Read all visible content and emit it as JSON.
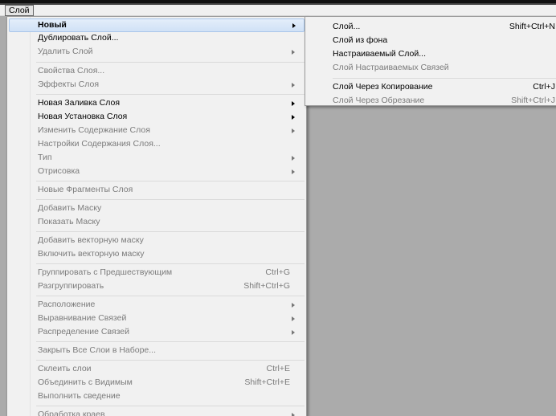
{
  "menubar": {
    "layer_menu": "Слой"
  },
  "menu": {
    "items": [
      {
        "label": "Новый",
        "shortcut": "",
        "submenu": true,
        "enabled": true,
        "highlight": true
      },
      {
        "label": "Дублировать Слой...",
        "shortcut": "",
        "submenu": false,
        "enabled": true
      },
      {
        "label": "Удалить Слой",
        "shortcut": "",
        "submenu": true,
        "enabled": false
      },
      {
        "label": "Свойства Слоя...",
        "shortcut": "",
        "submenu": false,
        "enabled": false
      },
      {
        "label": "Эффекты Слоя",
        "shortcut": "",
        "submenu": true,
        "enabled": false
      },
      {
        "label": "Новая Заливка Слоя",
        "shortcut": "",
        "submenu": true,
        "enabled": true
      },
      {
        "label": "Новая Установка Слоя",
        "shortcut": "",
        "submenu": true,
        "enabled": true
      },
      {
        "label": "Изменить Содержание Слоя",
        "shortcut": "",
        "submenu": true,
        "enabled": false
      },
      {
        "label": "Настройки Содержания Слоя...",
        "shortcut": "",
        "submenu": false,
        "enabled": false
      },
      {
        "label": "Тип",
        "shortcut": "",
        "submenu": true,
        "enabled": false
      },
      {
        "label": "Отрисовка",
        "shortcut": "",
        "submenu": true,
        "enabled": false
      },
      {
        "label": "Новые Фрагменты Слоя",
        "shortcut": "",
        "submenu": false,
        "enabled": false
      },
      {
        "label": "Добавить Маску",
        "shortcut": "",
        "submenu": false,
        "enabled": false
      },
      {
        "label": "Показать Маску",
        "shortcut": "",
        "submenu": false,
        "enabled": false
      },
      {
        "label": "Добавить векторную маску",
        "shortcut": "",
        "submenu": false,
        "enabled": false
      },
      {
        "label": "Включить векторную маску",
        "shortcut": "",
        "submenu": false,
        "enabled": false
      },
      {
        "label": "Группировать с Предшествующим",
        "shortcut": "Ctrl+G",
        "submenu": false,
        "enabled": false
      },
      {
        "label": "Разгруппировать",
        "shortcut": "Shift+Ctrl+G",
        "submenu": false,
        "enabled": false
      },
      {
        "label": "Расположение",
        "shortcut": "",
        "submenu": true,
        "enabled": false
      },
      {
        "label": "Выравнивание Связей",
        "shortcut": "",
        "submenu": true,
        "enabled": false
      },
      {
        "label": "Распределение Связей",
        "shortcut": "",
        "submenu": true,
        "enabled": false
      },
      {
        "label": "Закрыть Все Слои в Наборе...",
        "shortcut": "",
        "submenu": false,
        "enabled": false
      },
      {
        "label": "Склеить слои",
        "shortcut": "Ctrl+E",
        "submenu": false,
        "enabled": false
      },
      {
        "label": "Объединить с Видимым",
        "shortcut": "Shift+Ctrl+E",
        "submenu": false,
        "enabled": false
      },
      {
        "label": "Выполнить сведение",
        "shortcut": "",
        "submenu": false,
        "enabled": false
      },
      {
        "label": "Обработка краев",
        "shortcut": "",
        "submenu": true,
        "enabled": false
      }
    ]
  },
  "submenu": {
    "items": [
      {
        "label": "Слой...",
        "shortcut": "Shift+Ctrl+N",
        "enabled": true
      },
      {
        "label": "Слой из фона",
        "shortcut": "",
        "enabled": true
      },
      {
        "label": "Настраиваемый Слой...",
        "shortcut": "",
        "enabled": true
      },
      {
        "label": "Слой Настраиваемых Связей",
        "shortcut": "",
        "enabled": false
      },
      {
        "label": "Слой Через Копирование",
        "shortcut": "Ctrl+J",
        "enabled": true
      },
      {
        "label": "Слой Через Обрезание",
        "shortcut": "Shift+Ctrl+J",
        "enabled": false
      }
    ]
  }
}
